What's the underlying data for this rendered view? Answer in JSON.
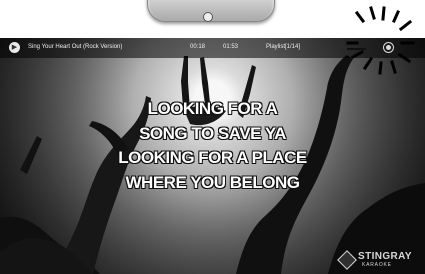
{
  "player": {
    "song_title": "Sing Your Heart Out (Rock Version)",
    "time_elapsed": "00:18",
    "time_total": "01:53",
    "playlist_count": "Playlist[1/14]"
  },
  "lyrics": [
    "LOOKING FOR A",
    "SONG TO SAVE YA",
    "LOOKING FOR A PLACE",
    "WHERE YOU BELONG"
  ],
  "branding": {
    "logo_name": "STINGRAY",
    "logo_subtitle": "KARAOKE"
  },
  "icons": {
    "play": "play-icon",
    "status": "status-light-icon",
    "logo": "stingray-logo-icon"
  },
  "colors": {
    "screen_bg": "#2a2a2a",
    "lyrics": "#ffffff",
    "overlay": "#000000"
  }
}
